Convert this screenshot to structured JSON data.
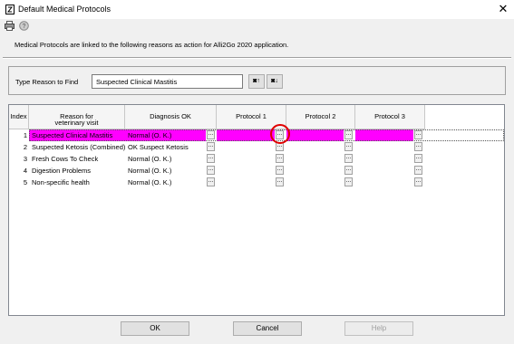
{
  "window": {
    "title": "Default Medical Protocols",
    "close_glyph": "✕"
  },
  "toolbar": {
    "icons": [
      "printer-icon",
      "help-icon"
    ]
  },
  "description": "Medical Protocols are linked to the following reasons as action for Alli2Go 2020 application.",
  "find": {
    "label": "Type Reason to Find",
    "value": "Suspected Clinical Mastitis",
    "search_up_label": "↑",
    "search_down_label": "↓"
  },
  "grid": {
    "headers": {
      "index": "Index",
      "reason_line1": "Reason for",
      "reason_line2": "veterinary visit",
      "diagnosis": "Diagnosis OK",
      "protocol1": "Protocol 1",
      "protocol2": "Protocol 2",
      "protocol3": "Protocol 3"
    },
    "ellipsis": "...",
    "rows": [
      {
        "index": "1",
        "reason": "Suspected Clinical Mastitis",
        "diagnosis": "Normal (O. K.)"
      },
      {
        "index": "2",
        "reason": "Suspected Ketosis (Combined)",
        "diagnosis": "OK Suspect Ketosis"
      },
      {
        "index": "3",
        "reason": "Fresh Cows To Check",
        "diagnosis": "Normal (O. K.)"
      },
      {
        "index": "4",
        "reason": "Digestion Problems",
        "diagnosis": "Normal (O. K.)"
      },
      {
        "index": "5",
        "reason": "Non-specific health",
        "diagnosis": "Normal (O. K.)"
      }
    ],
    "selected_row_color": "#ff00ff"
  },
  "buttons": {
    "ok": "OK",
    "cancel": "Cancel",
    "help": "Help"
  },
  "colors": {
    "highlight_circle": "#e00000",
    "dialog_bg": "#f0f0f0"
  }
}
